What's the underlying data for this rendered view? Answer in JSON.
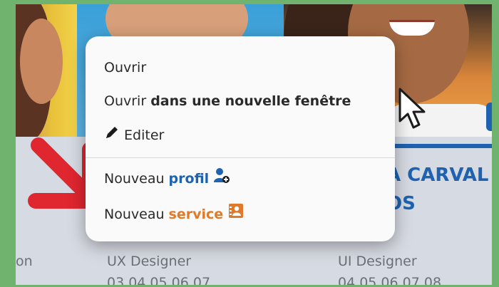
{
  "menu": {
    "open_label": "Ouvrir",
    "open_new_window_prefix": "Ouvrir",
    "open_new_window_bold": "dans une nouvelle fenêtre",
    "edit_label": "Editer",
    "new_profile_prefix": "Nouveau",
    "new_profile_highlight": "profil",
    "new_service_prefix": "Nouveau",
    "new_service_highlight": "service"
  },
  "cards": {
    "name_line1": "A CARVAL",
    "name_line2": "OS",
    "left_role_fragment": "on",
    "middle_role": "UX Designer",
    "middle_phone": "03 04 05 06 07",
    "right_role": "UI Designer",
    "right_phone": "04 05 06 07 08"
  },
  "icons": {
    "edit": "pencil-icon",
    "profile": "user-add-icon",
    "service": "contact-card-icon",
    "pointer": "mouse-cursor-icon",
    "annotation": "red-arrow-icon"
  },
  "colors": {
    "profile_accent": "#1e62b0",
    "service_accent": "#e07a2a",
    "annotation": "#e0262f",
    "background": "#6fb36f"
  }
}
